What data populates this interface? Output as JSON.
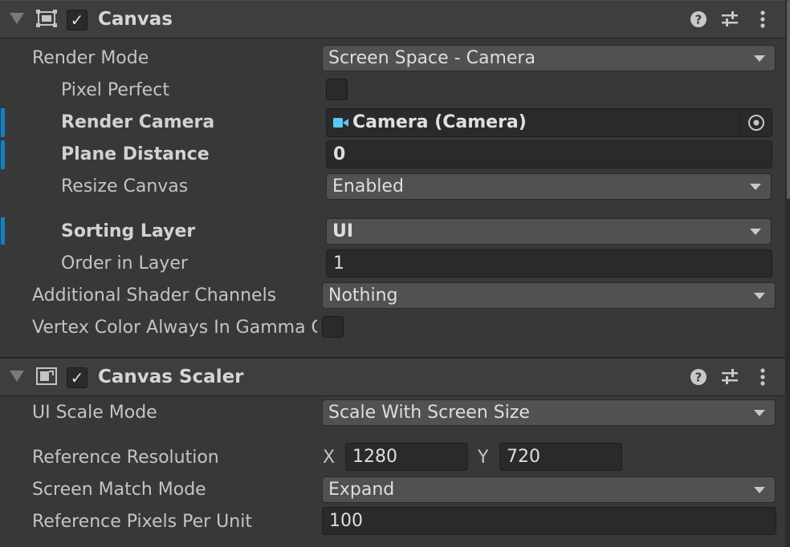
{
  "canvas": {
    "title": "Canvas",
    "enabled_mark": "✓",
    "render_mode": {
      "label": "Render Mode",
      "value": "Screen Space - Camera"
    },
    "pixel_perfect": {
      "label": "Pixel Perfect",
      "checked": false
    },
    "render_camera": {
      "label": "Render Camera",
      "value": "Camera (Camera)",
      "icon": "camera-icon"
    },
    "plane_distance": {
      "label": "Plane Distance",
      "value": "0"
    },
    "resize_canvas": {
      "label": "Resize Canvas",
      "value": "Enabled"
    },
    "sorting_layer": {
      "label": "Sorting Layer",
      "value": "UI"
    },
    "order_in_layer": {
      "label": "Order in Layer",
      "value": "1"
    },
    "additional_shader_channels": {
      "label": "Additional Shader Channels",
      "value": "Nothing"
    },
    "vertex_color_gamma": {
      "label": "Vertex Color Always In Gamma Color Space",
      "checked": false
    }
  },
  "canvas_scaler": {
    "title": "Canvas Scaler",
    "enabled_mark": "✓",
    "ui_scale_mode": {
      "label": "UI Scale Mode",
      "value": "Scale With Screen Size"
    },
    "reference_resolution": {
      "label": "Reference Resolution",
      "x_label": "X",
      "x": "1280",
      "y_label": "Y",
      "y": "720"
    },
    "screen_match_mode": {
      "label": "Screen Match Mode",
      "value": "Expand"
    },
    "reference_pixels_per_unit": {
      "label": "Reference Pixels Per Unit",
      "value": "100"
    }
  },
  "icons": {
    "help": "help-icon",
    "presets": "presets-icon",
    "menu": "kebab-menu-icon",
    "foldout": "foldout-arrow-icon",
    "object_picker": "object-picker-icon"
  },
  "colors": {
    "background": "#383838",
    "header": "#3e3e3e",
    "override_accent": "#0f81c8",
    "camera_icon": "#5ac8f0"
  }
}
